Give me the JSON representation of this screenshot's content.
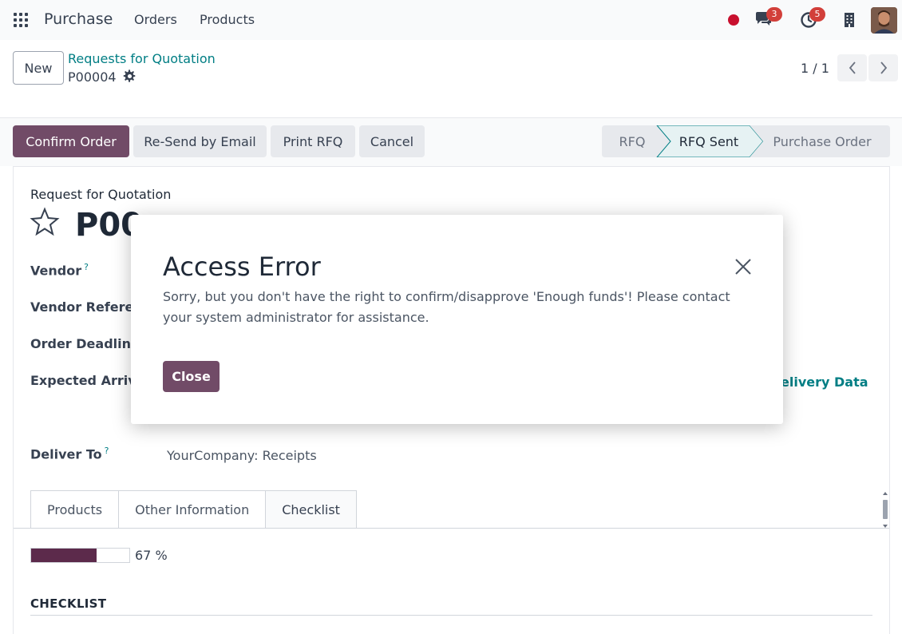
{
  "navbar": {
    "app_name": "Purchase",
    "menu": [
      "Orders",
      "Products"
    ],
    "chat_badge": "3",
    "activity_badge": "5",
    "icons": {
      "apps": "apps-grid-icon",
      "record": "record-dot-icon",
      "chat": "chat-icon",
      "activity": "clock-icon",
      "company": "building-icon"
    }
  },
  "control_panel": {
    "new_label": "New",
    "breadcrumb": "Requests for Quotation",
    "record": "P00004",
    "pager": "1 / 1"
  },
  "statusbar": {
    "buttons": [
      "Confirm Order",
      "Re-Send by Email",
      "Print RFQ",
      "Cancel"
    ],
    "stages": [
      "RFQ",
      "RFQ Sent",
      "Purchase Order"
    ],
    "active_stage": "RFQ Sent"
  },
  "form": {
    "doc_type": "Request for Quotation",
    "title_visible": "P00",
    "help_mark": "?",
    "labels": {
      "vendor": "Vendor",
      "vendor_reference": "Vendor Referer",
      "order_deadline": "Order Deadline",
      "expected_arrival": "Expected Arriva",
      "deliver_to": "Deliver To"
    },
    "deliver_to_value": "YourCompany: Receipts",
    "delivery_link": "elivery Data",
    "tabs": [
      "Products",
      "Other Information",
      "Checklist"
    ],
    "active_tab": "Checklist",
    "progress_value": 67,
    "progress_text": "67 %",
    "section_title": "CHECKLIST"
  },
  "modal": {
    "title": "Access Error",
    "message": "Sorry, but you don't have the right to confirm/disapprove 'Enough funds'! Please contact your system administrator for assistance.",
    "close_label": "Close"
  },
  "colors": {
    "primary": "#714b67",
    "link": "#017e84",
    "badge": "#d23f3a",
    "progress": "#5c2a4b"
  }
}
